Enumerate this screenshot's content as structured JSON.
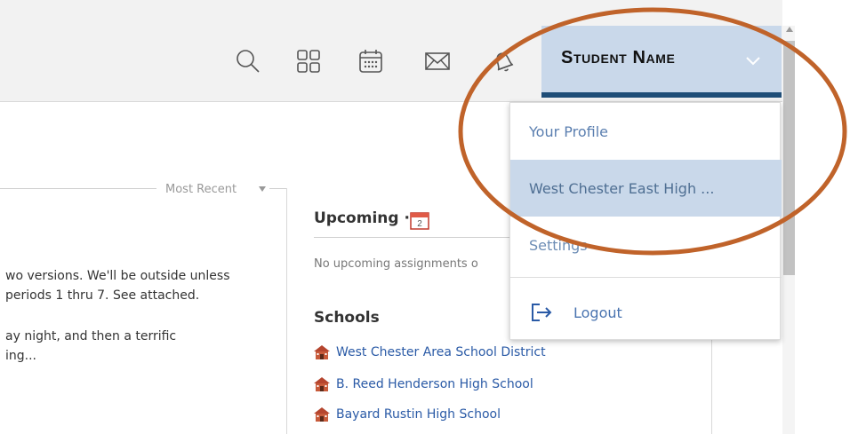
{
  "header": {
    "icons": [
      "search-icon",
      "apps-grid-icon",
      "calendar-icon",
      "mail-icon",
      "bell-icon"
    ],
    "user_name": "Student Name",
    "accent_color": "#1f4e78",
    "user_bg_color": "#c9d8ea"
  },
  "feed": {
    "filter_label": "Most Recent",
    "post1_line1": "wo versions. We'll be outside unless",
    "post1_line2": "periods 1 thru 7. See attached.",
    "post2_line1": "ay night, and then a terrific",
    "post2_line2": "ing..."
  },
  "upcoming": {
    "title": "Upcoming ·",
    "calendar_day": "2",
    "empty_text": "No upcoming assignments o"
  },
  "schools": {
    "title": "Schools",
    "items": [
      "West Chester Area School District",
      "B. Reed Henderson High School",
      "Bayard Rustin High School"
    ]
  },
  "user_menu": {
    "profile": "Your Profile",
    "school": "West Chester East High ...",
    "settings": "Settings",
    "logout": "Logout"
  },
  "annotation": {
    "color": "#c0632a"
  }
}
